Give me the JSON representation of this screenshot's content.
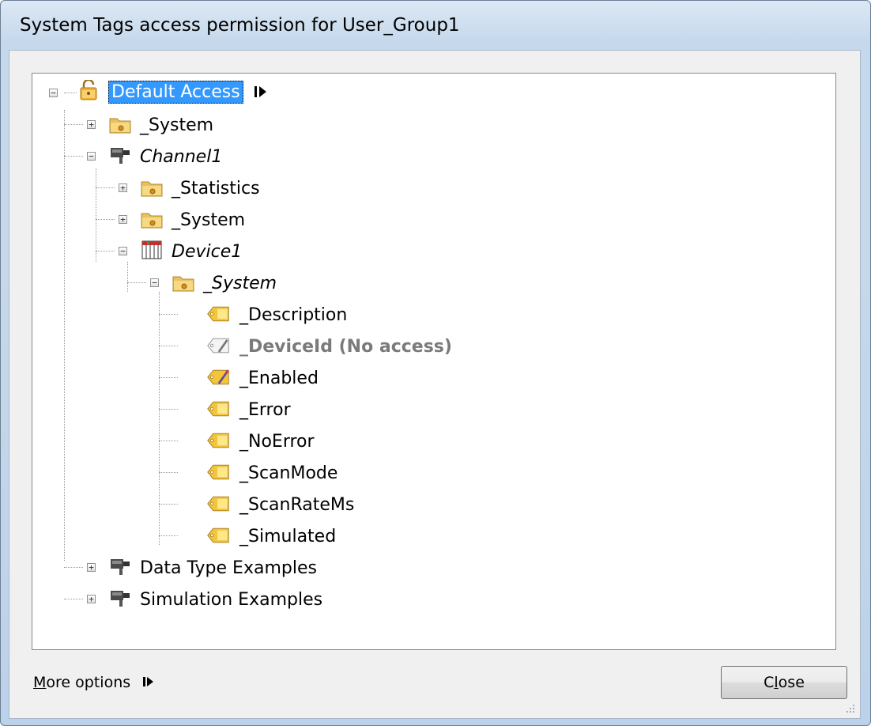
{
  "window": {
    "title": "System Tags access permission for User_Group1"
  },
  "tree": {
    "root": "Default Access",
    "system1": "_System",
    "channel": "Channel1",
    "statistics": "_Statistics",
    "system2": "_System",
    "device": "Device1",
    "system3": "_System",
    "tags": [
      "_Description",
      "_DeviceId (No access)",
      "_Enabled",
      "_Error",
      "_NoError",
      "_ScanMode",
      "_ScanRateMs",
      "_Simulated"
    ],
    "data_type": "Data Type Examples",
    "simulation": "Simulation Examples"
  },
  "footer": {
    "more_options_first": "M",
    "more_options_rest": "ore options",
    "close_label_pre": "C",
    "close_label_underlined": "l",
    "close_label_post": "ose"
  },
  "icons": {
    "root": "lock-icon",
    "folder": "folder-icon",
    "channel": "channel-icon",
    "device": "device-icon",
    "tag": "tag-icon",
    "tag_noaccess": "tag-no-access-icon",
    "tag_write": "tag-write-icon",
    "arrow": "arrow-right-icon"
  },
  "colors": {
    "selection": "#3399ff",
    "disabled_text": "#7a7a7a"
  }
}
